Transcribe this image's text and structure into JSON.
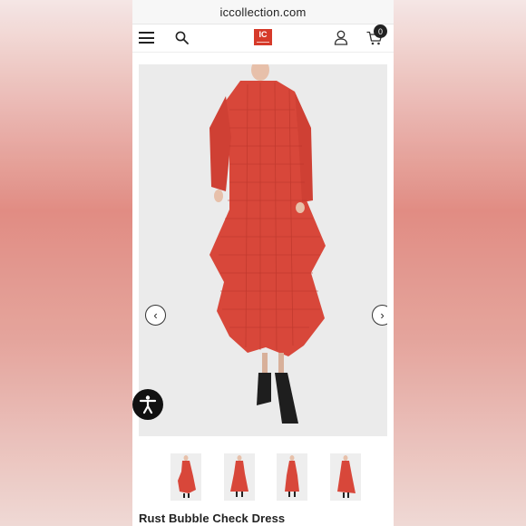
{
  "browser": {
    "url": "iccollection.com"
  },
  "header": {
    "logo_text": "IC",
    "cart_count": "0",
    "icons": [
      "menu-icon",
      "search-icon",
      "user-icon",
      "cart-icon"
    ]
  },
  "gallery": {
    "prev_label": "‹",
    "next_label": "›",
    "thumbnail_count": 4
  },
  "accessibility": {
    "icon": "accessibility-icon"
  },
  "product": {
    "title": "Rust Bubble Check Dress"
  },
  "colors": {
    "brand": "#d63a2a",
    "dress": "#d8473a",
    "background": "#ebebeb"
  }
}
